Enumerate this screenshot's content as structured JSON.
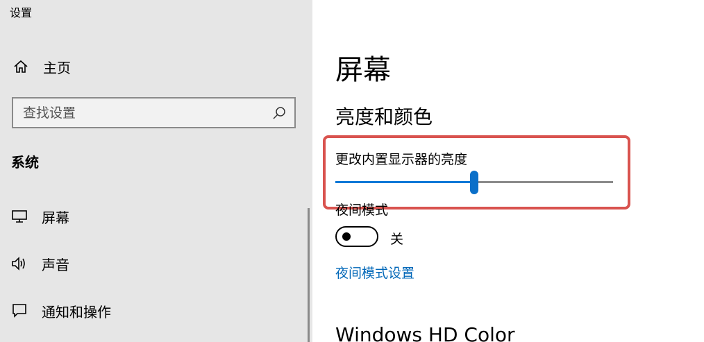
{
  "app": {
    "title": "设置"
  },
  "sidebar": {
    "home_label": "主页",
    "search": {
      "placeholder": "查找设置",
      "value": ""
    },
    "section_title": "系统",
    "items": [
      {
        "label": "屏幕",
        "icon": "monitor-icon"
      },
      {
        "label": "声音",
        "icon": "speaker-icon"
      },
      {
        "label": "通知和操作",
        "icon": "notification-icon"
      }
    ]
  },
  "main": {
    "page_title": "屏幕",
    "brightness_section": "亮度和颜色",
    "brightness_label": "更改内置显示器的亮度",
    "brightness_value": 50,
    "night_mode_label": "夜间模式",
    "night_mode_state": "关",
    "night_mode_on": false,
    "night_mode_settings_link": "夜间模式设置",
    "next_section": "Windows HD Color"
  },
  "colors": {
    "accent": "#0078d7",
    "link": "#0067b8",
    "highlight": "#d9534f",
    "sidebar_bg": "#e6e6e6"
  }
}
